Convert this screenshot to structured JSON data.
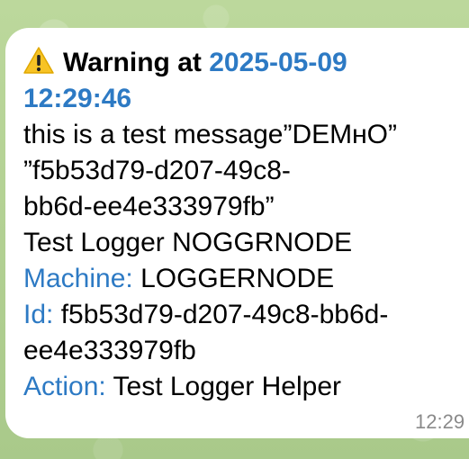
{
  "message": {
    "title_prefix": "Warning at",
    "title_date": "2025-05-09",
    "title_time": "12:29:46",
    "body_line1": "this is a test message”DEMʜO”",
    "body_line2": "”f5b53d79-d207-49c8-",
    "body_line3": "bb6d-ee4e333979fb”",
    "body_line4": "Test Logger NOGGRNODE",
    "machine_label": "Machine:",
    "machine_value": "LOGGERNODE",
    "id_label": "Id:",
    "id_value_line1": "f5b53d79-d207-49c8-bb6d-",
    "id_value_line2": "ee4e333979fb",
    "action_label": "Action:",
    "action_value": "Test Logger Helper",
    "timestamp": "12:29"
  },
  "icons": {
    "warning": "warning-icon"
  },
  "colors": {
    "label_blue": "#2d7ac4",
    "background_green": "#b9d59a",
    "warning_yellow": "#f7c325"
  }
}
